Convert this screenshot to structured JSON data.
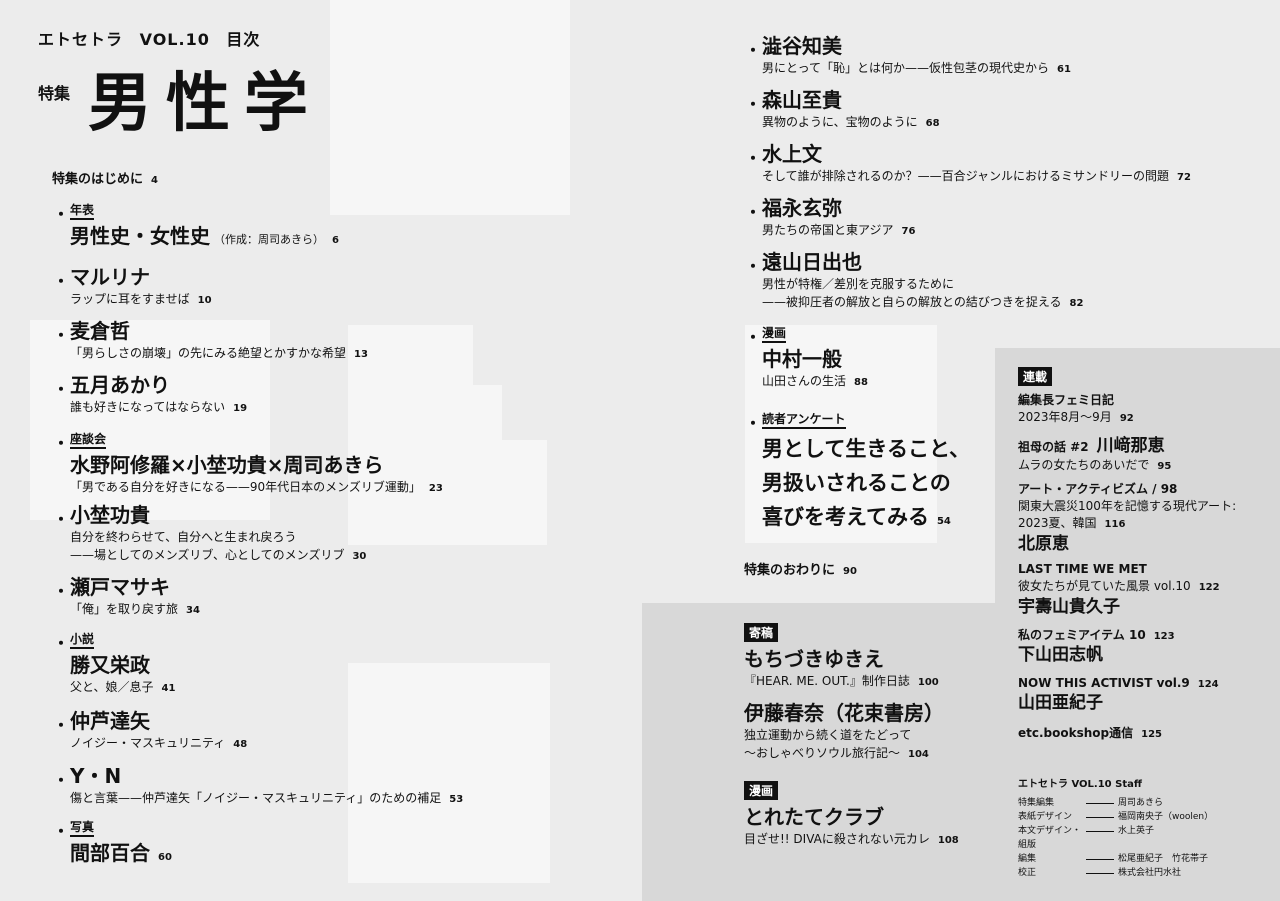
{
  "header": {
    "magazine": "エトセトラ",
    "volume": "VOL.10",
    "toc": "目次"
  },
  "feature": {
    "label": "特集",
    "title": "男性学"
  },
  "intro": {
    "label": "特集のはじめに",
    "page": "4"
  },
  "outro": {
    "label": "特集のおわりに",
    "page": "90"
  },
  "left_entries": [
    {
      "category": "年表",
      "name": "男性史・女性史",
      "note": "（作成：周司あきら）",
      "page": "6"
    },
    {
      "name": "マルリナ",
      "lines": [
        "ラップに耳をすませば"
      ],
      "page": "10"
    },
    {
      "name": "麦倉哲",
      "lines": [
        "「男らしさの崩壊」の先にみる絶望とかすかな希望"
      ],
      "page": "13"
    },
    {
      "name": "五月あかり",
      "lines": [
        "誰も好きになってはならない"
      ],
      "page": "19"
    },
    {
      "category": "座談会",
      "name": "水野阿修羅×小埜功貴×周司あきら",
      "lines": [
        "「男である自分を好きになる——90年代日本のメンズリブ運動」"
      ],
      "page": "23"
    },
    {
      "name": "小埜功貴",
      "lines": [
        "自分を終わらせて、自分へと生まれ戻ろう",
        "——場としてのメンズリブ、心としてのメンズリブ"
      ],
      "page": "30"
    },
    {
      "name": "瀬戸マサキ",
      "lines": [
        "「俺」を取り戻す旅"
      ],
      "page": "34"
    },
    {
      "category": "小説",
      "name": "勝又栄政",
      "lines": [
        "父と、娘／息子"
      ],
      "page": "41"
    },
    {
      "name": "仲芦達矢",
      "lines": [
        "ノイジー・マスキュリニティ"
      ],
      "page": "48"
    },
    {
      "name": "Y・N",
      "lines": [
        "傷と言葉——仲芦達矢「ノイジー・マスキュリニティ」のための補足"
      ],
      "page": "53"
    },
    {
      "category": "写真",
      "name": "間部百合",
      "page": "60"
    }
  ],
  "right_entries": [
    {
      "name": "澁谷知美",
      "lines": [
        "男にとって「恥」とは何か——仮性包茎の現代史から"
      ],
      "page": "61"
    },
    {
      "name": "森山至貴",
      "lines": [
        "異物のように、宝物のように"
      ],
      "page": "68"
    },
    {
      "name": "水上文",
      "lines": [
        "そして誰が排除されるのか？——百合ジャンルにおけるミサンドリーの問題"
      ],
      "page": "72"
    },
    {
      "name": "福永玄弥",
      "lines": [
        "男たちの帝国と東アジア"
      ],
      "page": "76"
    },
    {
      "name": "遠山日出也",
      "lines": [
        "男性が特権／差別を克服するために",
        "——被抑圧者の解放と自らの解放との結びつきを捉える"
      ],
      "page": "82"
    },
    {
      "category": "漫画",
      "name": "中村一般",
      "lines": [
        "山田さんの生活"
      ],
      "page": "88"
    }
  ],
  "survey": {
    "category": "読者アンケート",
    "lines": [
      "男として生きること、",
      "男扱いされることの",
      "喜びを考えてみる"
    ],
    "page": "54"
  },
  "contrib": {
    "label": "寄稿",
    "items": [
      {
        "name": "もちづきゆきえ",
        "lines": [
          "『HEAR. ME. OUT.』制作日誌"
        ],
        "page": "100"
      },
      {
        "name": "伊藤春奈（花束書房）",
        "lines": [
          "独立運動から続く道をたどって",
          "〜おしゃべりソウル旅行記〜"
        ],
        "page": "104"
      }
    ]
  },
  "manga": {
    "label": "漫画",
    "name": "とれたてクラブ",
    "line": "目ざせ!! DIVAに殺されない元カレ",
    "page": "108"
  },
  "serial": {
    "label": "連載",
    "items": [
      {
        "title": "編集長フェミ日記",
        "sub": "2023年8月〜9月",
        "page": "92"
      },
      {
        "title": "祖母の話 #2",
        "name_inline": "川﨑那恵",
        "sub": "ムラの女たちのあいだで",
        "page": "95"
      },
      {
        "title": "アート・アクティビズム / 98",
        "sub": "関東大震災100年を記憶する現代アート:",
        "sub2": "2023夏、韓国",
        "page": "116",
        "name": "北原恵"
      },
      {
        "title": "LAST TIME WE MET",
        "sub": "彼女たちが見ていた風景 vol.10",
        "page": "122",
        "name": "宇壽山貴久子"
      },
      {
        "title": "私のフェミアイテム 10",
        "page": "123",
        "name": "下山田志帆"
      },
      {
        "title": "NOW THIS ACTIVIST vol.9",
        "page": "124",
        "name": "山田亜紀子"
      },
      {
        "title": "etc.bookshop通信",
        "page": "125"
      }
    ]
  },
  "staff": {
    "title": "エトセトラ VOL.10  Staff",
    "rows": [
      {
        "role": "特集編集",
        "person": "周司あきら"
      },
      {
        "role": "表紙デザイン",
        "person": "福岡南央子（woolen）"
      },
      {
        "role": "本文デザイン・組版",
        "person": "水上英子"
      },
      {
        "role": "編集",
        "person": "松尾亜紀子　竹花帯子"
      },
      {
        "role": "校正",
        "person": "株式会社円水社"
      }
    ]
  }
}
